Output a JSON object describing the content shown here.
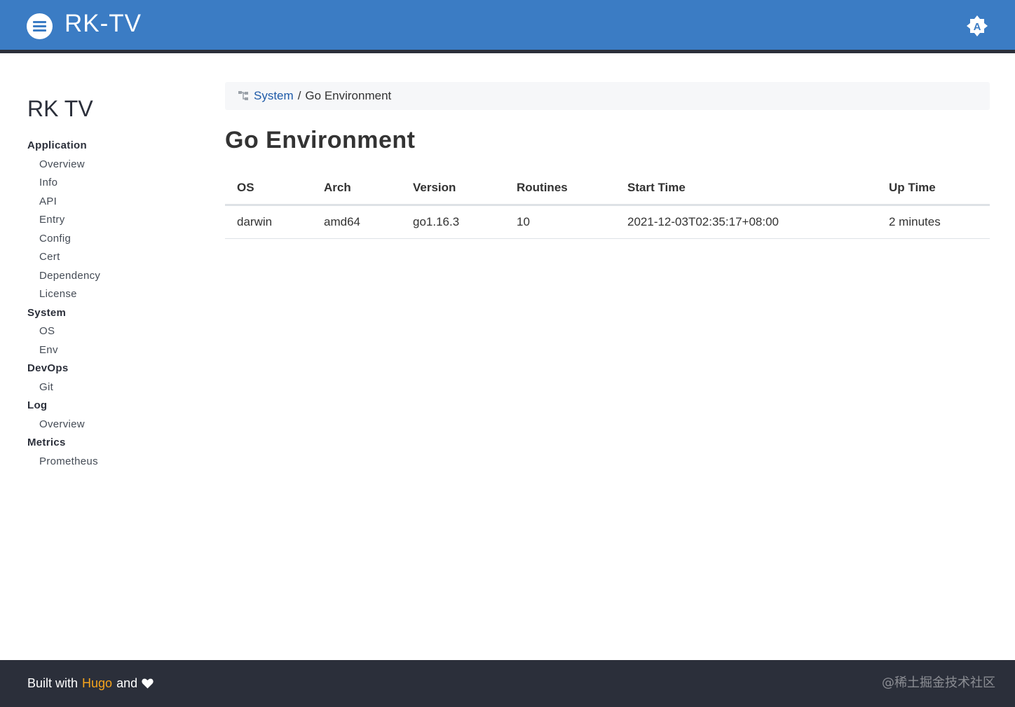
{
  "header": {
    "brand": "RK-TV",
    "menu_icon": "hamburger-icon",
    "theme_icon": "auto-theme-icon",
    "theme_letter": "A",
    "colors": {
      "bar": "#3b7cc4",
      "bar_border": "#2b2f3a"
    }
  },
  "sidebar": {
    "title": "RK TV",
    "sections": [
      {
        "label": "Application",
        "items": [
          "Overview",
          "Info",
          "API",
          "Entry",
          "Config",
          "Cert",
          "Dependency",
          "License"
        ]
      },
      {
        "label": "System",
        "items": [
          "OS",
          "Env"
        ]
      },
      {
        "label": "DevOps",
        "items": [
          "Git"
        ]
      },
      {
        "label": "Log",
        "items": [
          "Overview"
        ]
      },
      {
        "label": "Metrics",
        "items": [
          "Prometheus"
        ]
      }
    ]
  },
  "breadcrumb": {
    "icon": "sitemap-icon",
    "parent": "System",
    "separator": "/",
    "current": "Go Environment"
  },
  "main": {
    "title": "Go Environment",
    "table": {
      "headers": [
        "OS",
        "Arch",
        "Version",
        "Routines",
        "Start Time",
        "Up Time"
      ],
      "rows": [
        [
          "darwin",
          "amd64",
          "go1.16.3",
          "10",
          "2021-12-03T02:35:17+08:00",
          "2 minutes"
        ]
      ]
    }
  },
  "footer": {
    "built_with": "Built with",
    "hugo": "Hugo",
    "and": "and",
    "heart_icon": "heart-icon",
    "watermark": "@稀土掘金技术社区",
    "colors": {
      "background": "#2b2f3a",
      "hugo": "#f7a41c"
    }
  }
}
